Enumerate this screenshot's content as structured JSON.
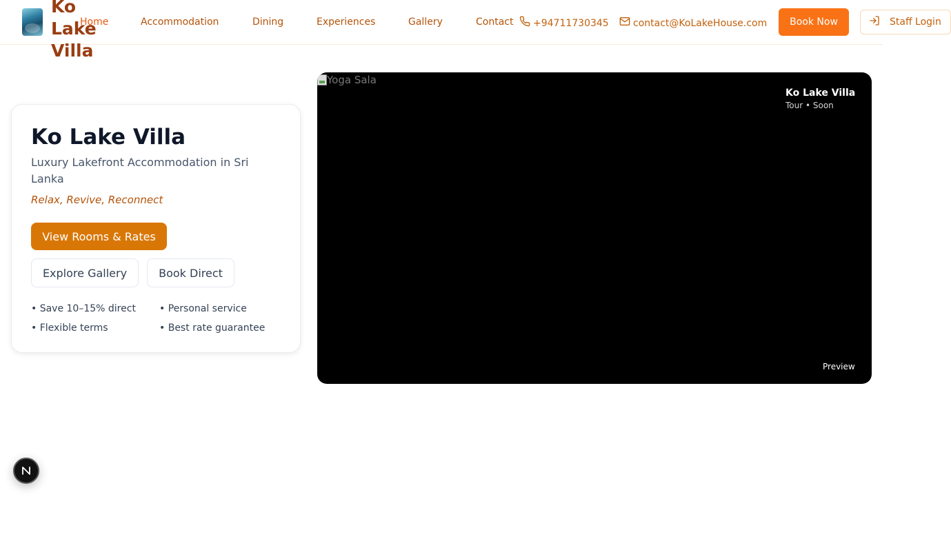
{
  "header": {
    "brand": "Ko Lake Villa",
    "nav": [
      "Home",
      "Accommodation",
      "Dining",
      "Experiences",
      "Gallery",
      "Contact"
    ],
    "phone": "+94711730345",
    "email": "contact@KoLakeHouse.com",
    "book_now": "Book Now",
    "staff_login": "Staff Login"
  },
  "hero": {
    "title": "Ko Lake Villa",
    "subtitle": "Luxury Lakefront Accommodation in Sri Lanka",
    "tagline": "Relax, Revive, Reconnect",
    "primary_button": "View Rooms & Rates",
    "gallery_button": "Explore Gallery",
    "direct_button": "Book Direct",
    "perks": [
      "• Save 10–15% direct",
      "• Personal service",
      "• Flexible terms",
      "• Best rate guarantee"
    ]
  },
  "preview": {
    "image_alt": "Yoga Sala",
    "title": "Ko Lake Villa",
    "meta": "Tour • Soon",
    "label": "Preview"
  },
  "badge": {
    "letter": "N"
  },
  "colors": {
    "accent": "#f97316",
    "brand": "#9a3d12",
    "primary_button": "#d97706"
  }
}
